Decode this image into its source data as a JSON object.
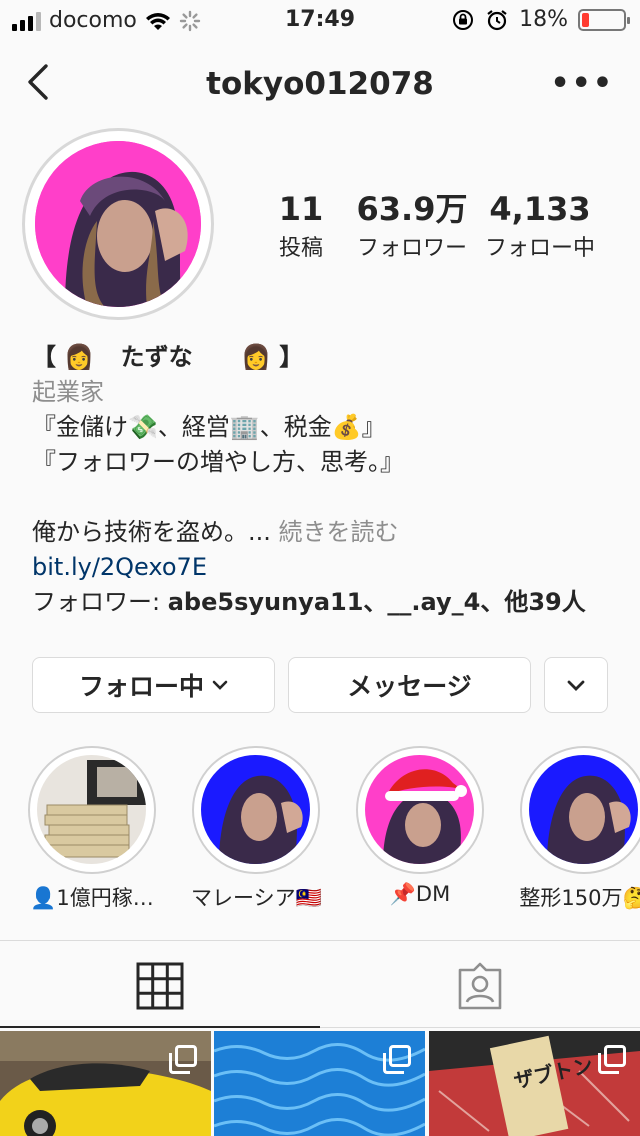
{
  "status_bar": {
    "carrier": "docomo",
    "time": "17:49",
    "battery_percent": "18%",
    "battery_level": 0.18
  },
  "header": {
    "username": "tokyo012078",
    "back_icon": "chevron-left-icon",
    "more_icon": "more-dots-icon"
  },
  "stats": {
    "posts": {
      "count": "11",
      "label": "投稿"
    },
    "followers": {
      "count": "63.9万",
      "label": "フォロワー"
    },
    "following": {
      "count": "4,133",
      "label": "フォロー中"
    }
  },
  "bio": {
    "name_open": "【",
    "name_text": "たずな",
    "name_close": "】",
    "category": "起業家",
    "line1_a": "『金儲け",
    "line1_b": "、経営",
    "line1_c": "、税金",
    "line1_d": "』",
    "line2": "『フォロワーの増やし方、思考。』",
    "line3": "俺から技術を盗め。...",
    "read_more": "続きを読む",
    "link": "bit.ly/2Qexo7E",
    "followed_prefix": "フォロワー: ",
    "followed_names": "abe5syunya11、__.ay_4、他39人"
  },
  "buttons": {
    "following": "フォロー中",
    "message": "メッセージ"
  },
  "highlights": [
    {
      "label": "👤1億円稼…"
    },
    {
      "label": "マレーシア🇲🇾"
    },
    {
      "label": "📌DM"
    },
    {
      "label": "整形150万🤔"
    }
  ],
  "grid": [
    {
      "image": "yellow-sports-car"
    },
    {
      "image": "pool-water"
    },
    {
      "image": "wagyu-beef-with-sign",
      "sign_text": "ザブトン"
    }
  ],
  "colors": {
    "accent_pink": "#ff3fc9",
    "accent_blue": "#1a1aff",
    "link": "#003569",
    "muted": "#8e8e8e"
  }
}
